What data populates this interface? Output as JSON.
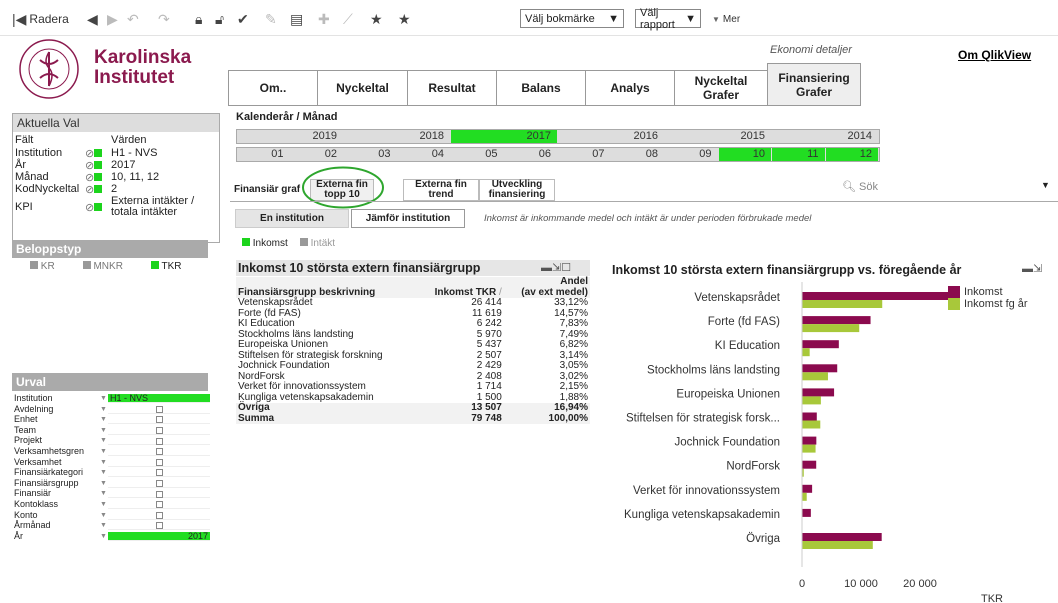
{
  "toolbar": {
    "clear_label": "Radera",
    "bookmark_select": "Välj bokmärke",
    "report_select": "Välj rapport",
    "more_label": "Mer"
  },
  "logo": {
    "line1": "Karolinska",
    "line2": "Institutet",
    "seal_text": "KAROLINSKA INSTITUTET · ANNO 1810 ·"
  },
  "header": {
    "subtitle": "Ekonomi detaljer",
    "about_link": "Om QlikView"
  },
  "main_tabs": [
    {
      "label": "Om.."
    },
    {
      "label": "Nyckeltal"
    },
    {
      "label": "Resultat"
    },
    {
      "label": "Balans"
    },
    {
      "label": "Analys"
    },
    {
      "label": "Nyckeltal Grafer"
    },
    {
      "label": "Finansiering Grafer"
    }
  ],
  "current_selections": {
    "title": "Aktuella Val",
    "col_field": "Fält",
    "col_values": "Värden",
    "rows": [
      {
        "field": "Institution",
        "value": "H1 - NVS"
      },
      {
        "field": "År",
        "value": "2017"
      },
      {
        "field": "Månad",
        "value": "10, 11, 12"
      },
      {
        "field": "KodNyckeltal",
        "value": "2"
      },
      {
        "field": "KPI",
        "value": "Externa intäkter / totala intäkter"
      }
    ]
  },
  "calendar": {
    "title": "Kalenderår / Månad",
    "years": [
      "2019",
      "2018",
      "2017",
      "2016",
      "2015",
      "2014"
    ],
    "months": [
      "01",
      "02",
      "03",
      "04",
      "05",
      "06",
      "07",
      "08",
      "09",
      "10",
      "11",
      "12"
    ]
  },
  "sub_tabs": [
    {
      "label": "Finansiär graf"
    },
    {
      "label": "Externa fin topp 10"
    },
    {
      "label": "Externa fin trend"
    },
    {
      "label": "Utveckling finansiering"
    }
  ],
  "search_label": "Sök",
  "compare_buttons": {
    "single": "En institution",
    "compare": "Jämför institution"
  },
  "info_text": "Inkomst är inkommande medel och intäkt är under perioden förbrukade medel",
  "measure_toggle": {
    "income": "Inkomst",
    "revenue": "Intäkt"
  },
  "belopp": {
    "title": "Beloppstyp",
    "options": [
      "KR",
      "MNKR",
      "TKR"
    ]
  },
  "table": {
    "title": "Inkomst 10 största extern finansiärgrupp",
    "col1": "Finansiärsgrupp beskrivning",
    "col2": "Inkomst TKR",
    "col3a": "Andel",
    "col3b": "(av ext medel)",
    "rows": [
      {
        "name": "Vetenskapsrådet",
        "amount": "26 414",
        "share": "33,12%"
      },
      {
        "name": "Forte (fd FAS)",
        "amount": "11 619",
        "share": "14,57%"
      },
      {
        "name": "KI Education",
        "amount": "6 242",
        "share": "7,83%"
      },
      {
        "name": "Stockholms läns landsting",
        "amount": "5 970",
        "share": "7,49%"
      },
      {
        "name": "Europeiska Unionen",
        "amount": "5 437",
        "share": "6,82%"
      },
      {
        "name": "Stiftelsen för strategisk forskning",
        "amount": "2 507",
        "share": "3,14%"
      },
      {
        "name": "Jochnick Foundation",
        "amount": "2 429",
        "share": "3,05%"
      },
      {
        "name": "NordForsk",
        "amount": "2 408",
        "share": "3,02%"
      },
      {
        "name": "Verket för innovationssystem",
        "amount": "1 714",
        "share": "2,15%"
      },
      {
        "name": "Kungliga vetenskapsakademin",
        "amount": "1 500",
        "share": "1,88%"
      }
    ],
    "other": {
      "name": "Övriga",
      "amount": "13 507",
      "share": "16,94%"
    },
    "total": {
      "name": "Summa",
      "amount": "79 748",
      "share": "100,00%"
    }
  },
  "urval": {
    "title": "Urval",
    "rows": [
      {
        "label": "Institution",
        "value": "H1 - NVS",
        "selected": true
      },
      {
        "label": "Avdelning",
        "value": ""
      },
      {
        "label": "Enhet",
        "value": ""
      },
      {
        "label": "Team",
        "value": ""
      },
      {
        "label": "Projekt",
        "value": ""
      },
      {
        "label": "Verksamhetsgren",
        "value": ""
      },
      {
        "label": "Verksamhet",
        "value": ""
      },
      {
        "label": "Finansiärkategori",
        "value": ""
      },
      {
        "label": "Finansiärsgrupp",
        "value": ""
      },
      {
        "label": "Finansiär",
        "value": ""
      },
      {
        "label": "Kontoklass",
        "value": ""
      },
      {
        "label": "Konto",
        "value": ""
      },
      {
        "label": "Årmånad",
        "value": ""
      },
      {
        "label": "År",
        "value": "2017",
        "selected": true
      }
    ]
  },
  "chart_data": {
    "type": "bar",
    "orientation": "horizontal",
    "title": "Inkomst 10 största extern finansiärgrupp vs. föregående år",
    "xlabel": "TKR",
    "categories": [
      "Vetenskapsrådet",
      "Forte (fd FAS)",
      "KI Education",
      "Stockholms läns landsting",
      "Europeiska Unionen",
      "Stiftelsen för strategisk forsk...",
      "Jochnick Foundation",
      "NordForsk",
      "Verket för innovationssystem",
      "Kungliga vetenskapsakademin",
      "Övriga"
    ],
    "series": [
      {
        "name": "Inkomst",
        "color": "#8b0a4e",
        "values": [
          26414,
          11619,
          6242,
          5970,
          5437,
          2507,
          2429,
          2408,
          1714,
          1500,
          13507
        ]
      },
      {
        "name": "Inkomst fg år",
        "color": "#a8c83a",
        "values": [
          13600,
          9700,
          1300,
          4400,
          3200,
          3100,
          2300,
          300,
          800,
          0,
          12000
        ]
      }
    ],
    "xticks": [
      "0",
      "10 000",
      "20 000"
    ],
    "xlim": [
      0,
      26414
    ],
    "legend_position": "top-right"
  }
}
